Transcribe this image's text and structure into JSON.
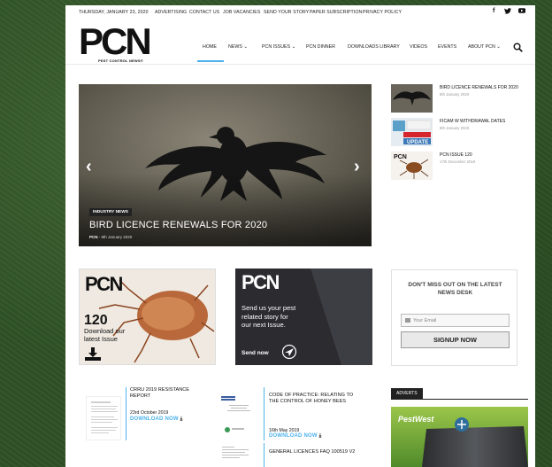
{
  "topbar": {
    "date": "THURSDAY, JANUARY 23, 2020",
    "links": [
      "ADVERTISING",
      "CONTACT US",
      "JOB VACANCIES",
      "SEND YOUR STORY",
      "PAPER SUBSCRIPTION",
      "PRIVACY POLICY"
    ],
    "social": [
      "f",
      "🐦",
      "▶"
    ]
  },
  "logo": {
    "text": "PCN",
    "subtitle": "PEST CONTROL NEWS®"
  },
  "nav": {
    "items": [
      "HOME",
      "NEWS",
      "PCN ISSUES",
      "PCN DINNER",
      "DOWNLOADS LIBRARY",
      "VIDEOS",
      "EVENTS",
      "ABOUT PCN"
    ],
    "dropdown_marker": "⌄",
    "active": "HOME"
  },
  "hero": {
    "category": "INDUSTRY NEWS",
    "title": "BIRD LICENCE RENEWALS FOR 2020",
    "author": "PCN",
    "date": "8th January 2020",
    "prev": "‹",
    "next": "›"
  },
  "side_posts": [
    {
      "title": "BIRD LICENCE RENEWALS FOR 2020",
      "date": "8th January 2020"
    },
    {
      "title": "FICAM W WITHDRAWAL DATES",
      "date": "8th January 2020"
    },
    {
      "title": "PCN ISSUE 120",
      "date": "17th December 2019"
    }
  ],
  "promo_issue": {
    "logo": "PCN",
    "issue_number": "120",
    "line1": "Download our",
    "line2": "latest Issue"
  },
  "promo_story": {
    "logo": "PCN",
    "text": "Send us your pest related story for our next Issue.",
    "cta": "Send now"
  },
  "signup": {
    "heading": "DON'T MISS OUT ON THE LATEST NEWS DESK",
    "placeholder": "Your Email",
    "button": "SIGNUP NOW"
  },
  "downloads": [
    {
      "title": "CRRU 2019 RESISTANCE REPORT",
      "date": "23rd October 2019",
      "cta": "DOWNLOAD NOW"
    },
    {
      "title": "CODE OF PRACTICE: RELATING TO THE CONTROL OF HONEY BEES",
      "date": "16th May 2019",
      "cta": "DOWNLOAD NOW"
    },
    {
      "title": "GENERAL LICENCES FAQ 100519 V2",
      "date": "",
      "cta": ""
    }
  ],
  "adverts": {
    "label": "ADVERTS",
    "brand": "PestWest"
  },
  "colors": {
    "accent": "#4db2ec",
    "background": "#2f5226"
  }
}
